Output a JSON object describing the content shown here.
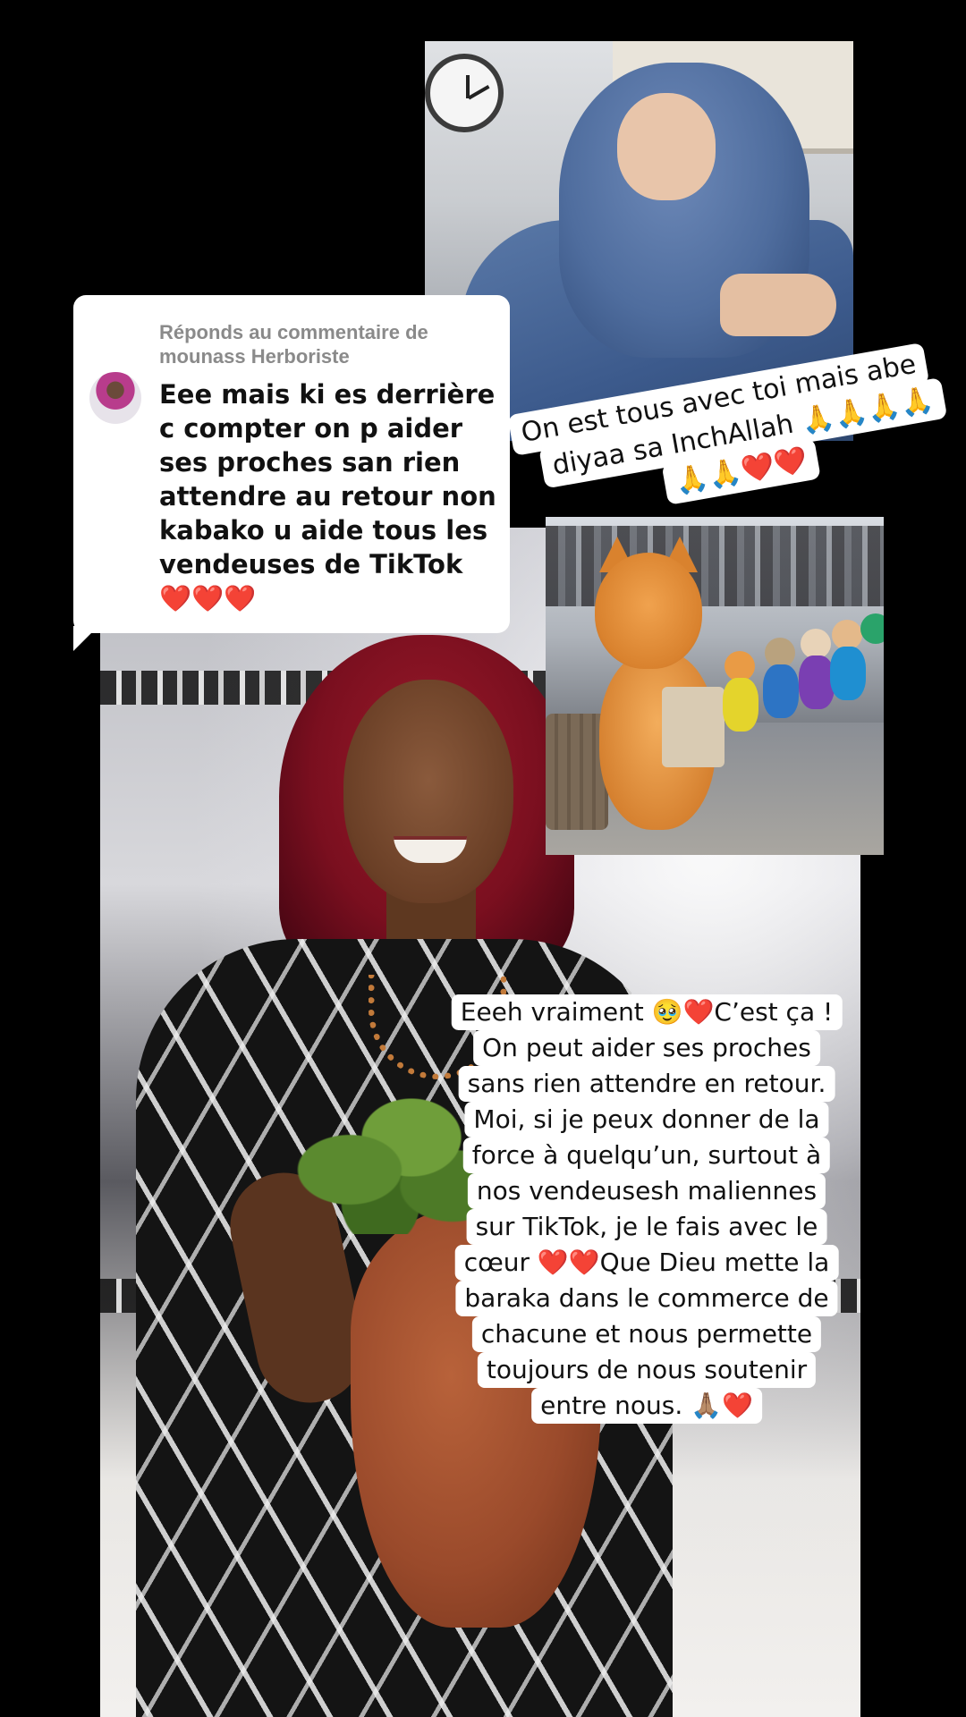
{
  "comment": {
    "reply_label": "Réponds au commentaire de mounass Herboriste",
    "text": "Eee mais ki es derrière c compter on p aider ses proches san rien attendre au retour non kabako u aide tous les vendeuses de TikTok ❤️❤️❤️"
  },
  "sticker_top": {
    "lines": [
      "On est tous avec toi mais abe",
      "diyaa sa InchAllah 🙏🙏🙏🙏",
      "🙏🙏❤️❤️"
    ]
  },
  "caption_main": {
    "lines": [
      "Eeeh vraiment 🥹❤️C’est ça !",
      "On peut aider ses proches",
      "sans rien attendre en retour.",
      "Moi, si je peux donner de la",
      "force à quelqu’un, surtout à",
      "nos vendeusesh maliennes",
      "sur TikTok, je le fais avec le",
      "cœur ❤️❤️Que Dieu mette la",
      "baraka dans le commerce de",
      "chacune et nous permette",
      "toujours de nous soutenir",
      "entre nous. 🙏🏽❤️"
    ]
  },
  "colors": {
    "background": "#000000",
    "card": "#ffffff",
    "reply_label": "#8a8a8a",
    "text": "#111111",
    "hair": "#8b1525",
    "hijab": "#4f6d9e",
    "cat": "#d9822e"
  }
}
